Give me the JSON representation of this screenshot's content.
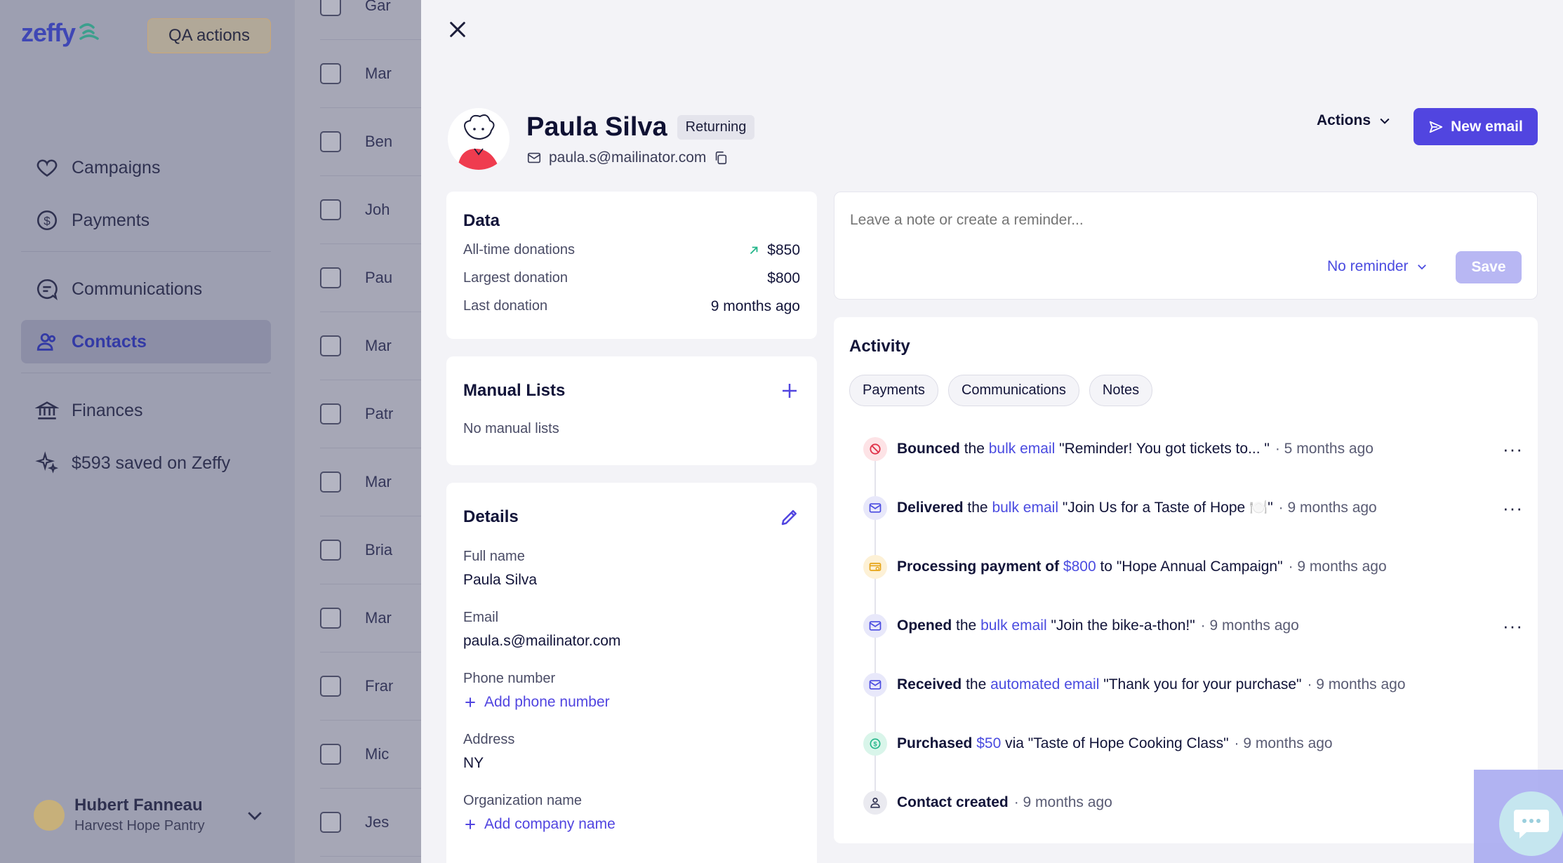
{
  "sidebar": {
    "logo": "zeffy",
    "qa_button": "QA actions",
    "nav": [
      {
        "label": "Campaigns",
        "icon": "heart-icon"
      },
      {
        "label": "Payments",
        "icon": "dollar-circle-icon"
      },
      {
        "label": "Communications",
        "icon": "chat-icon"
      },
      {
        "label": "Contacts",
        "icon": "contacts-icon",
        "active": true
      },
      {
        "label": "Finances",
        "icon": "bank-icon"
      },
      {
        "label": "$593 saved on Zeffy",
        "icon": "sparkle-icon"
      }
    ],
    "user": {
      "name": "Hubert Fanneau",
      "org": "Harvest Hope Pantry"
    }
  },
  "bg_list": [
    "Gar",
    "Mar",
    "Ben",
    "Joh",
    "Pau",
    "Mar",
    "Patr",
    "Mar",
    "Bria",
    "Mar",
    "Fran",
    "Mic",
    "Jes"
  ],
  "contact": {
    "name": "Paula Silva",
    "badge": "Returning",
    "email": "paula.s@mailinator.com",
    "actions_label": "Actions",
    "new_email_label": "New email"
  },
  "data_card": {
    "title": "Data",
    "rows": [
      {
        "label": "All-time donations",
        "value": "$850"
      },
      {
        "label": "Largest donation",
        "value": "$800"
      },
      {
        "label": "Last donation",
        "value": "9 months ago"
      }
    ]
  },
  "manual_lists": {
    "title": "Manual Lists",
    "empty": "No manual lists"
  },
  "details": {
    "title": "Details",
    "full_name_label": "Full name",
    "full_name": "Paula Silva",
    "email_label": "Email",
    "email": "paula.s@mailinator.com",
    "phone_label": "Phone number",
    "phone_add": "Add phone number",
    "address_label": "Address",
    "address": "NY",
    "org_label": "Organization name",
    "org_add": "Add company name"
  },
  "note": {
    "placeholder": "Leave a note or create a reminder...",
    "reminder": "No reminder",
    "save": "Save"
  },
  "activity": {
    "title": "Activity",
    "tabs": [
      "Payments",
      "Communications",
      "Notes"
    ],
    "items": [
      {
        "icon": "bounce-icon",
        "verb": "Bounced",
        "mid": "the",
        "link": "bulk email",
        "rest": "\"Reminder! You got tickets to... \"",
        "when": "· 5 months ago",
        "menu": "···"
      },
      {
        "icon": "mail-icon",
        "verb": "Delivered",
        "mid": "the",
        "link": "bulk email",
        "rest": "\"Join Us for a Taste of Hope 🍽️\"",
        "when": "· 9 months ago",
        "menu": "···"
      },
      {
        "icon": "card-icon",
        "verb": "Processing payment of",
        "mid": "",
        "link": "$800",
        "rest": "to \"Hope Annual Campaign\"",
        "when": "· 9 months ago",
        "menu": ""
      },
      {
        "icon": "mail-icon",
        "verb": "Opened",
        "mid": "the",
        "link": "bulk email",
        "rest": "\"Join the bike-a-thon!\"",
        "when": "· 9 months ago",
        "menu": "···"
      },
      {
        "icon": "mail-icon",
        "verb": "Received",
        "mid": "the",
        "link": "automated email",
        "rest": "\"Thank you for your purchase\"",
        "when": "· 9 months ago",
        "menu": ""
      },
      {
        "icon": "dollar-icon",
        "verb": "Purchased",
        "mid": "",
        "link": "$50",
        "rest": "via \"Taste of Hope Cooking Class\"",
        "when": "· 9 months ago",
        "menu": ""
      },
      {
        "icon": "person-icon",
        "verb": "Contact created",
        "mid": "",
        "link": "",
        "rest": "",
        "when": "· 9 months ago",
        "menu": ""
      }
    ]
  },
  "colors": {
    "accent": "#5145e0",
    "link": "#4a4be0",
    "bounce": "#e0334a",
    "payment": "#e6a417",
    "success": "#23b68a"
  }
}
